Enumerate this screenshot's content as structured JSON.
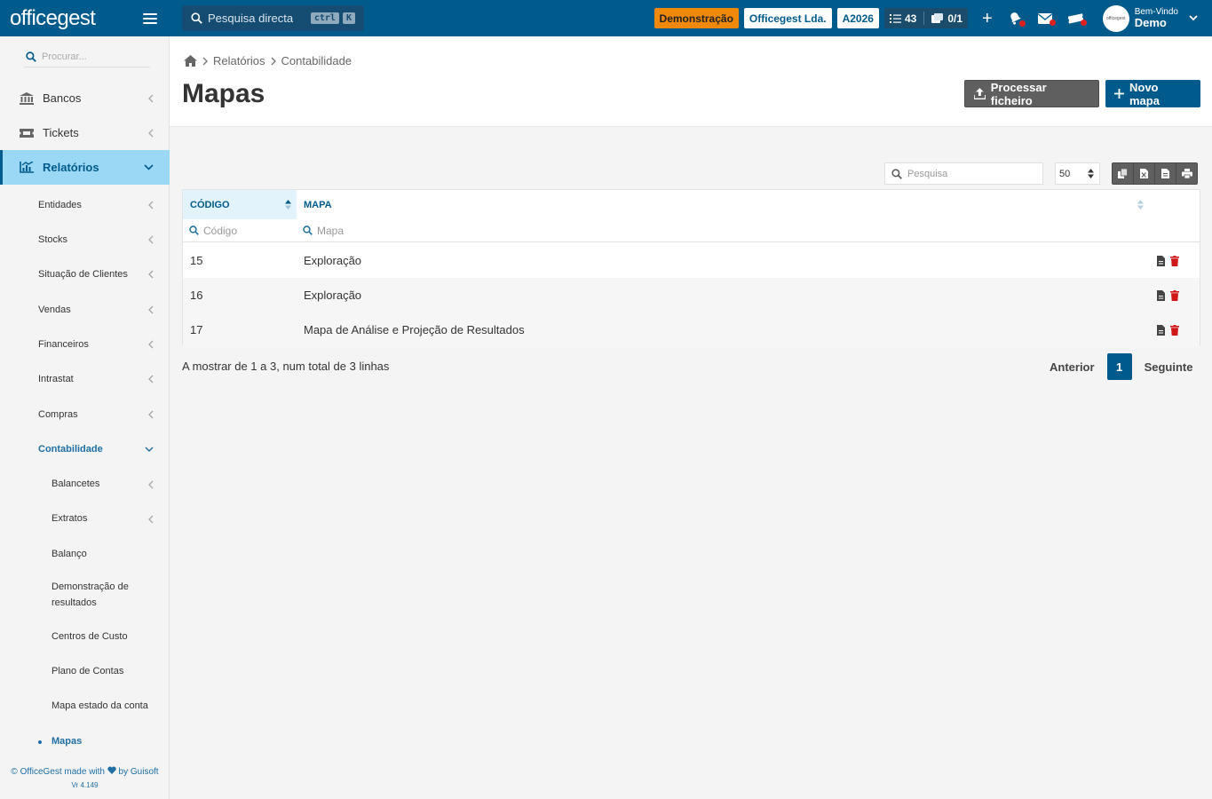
{
  "brand": {
    "logo": "officegest"
  },
  "topbar": {
    "quick_search_label": "Pesquisa directa",
    "kbd_ctrl": "ctrl",
    "kbd_k": "K",
    "demo_badge": "Demonstração",
    "company": "Officegest Lda.",
    "year": "A2026",
    "tasks_count": "43",
    "docs_count": "0/1",
    "welcome_line": "Bem-Vindo",
    "user_name": "Demo",
    "colors": {
      "bar": "#005b8c",
      "demo": "#f0890a",
      "alert_dot": "#e02020"
    }
  },
  "sidebar": {
    "search_placeholder": "Procurar...",
    "top_items": [
      {
        "label": "Bancos",
        "icon": "bank-icon"
      },
      {
        "label": "Tickets",
        "icon": "ticket-icon"
      },
      {
        "label": "Relatórios",
        "icon": "chart-icon"
      }
    ],
    "report_items": [
      "Entidades",
      "Stocks",
      "Situação de Clientes",
      "Vendas",
      "Financeiros",
      "Intrastat",
      "Compras",
      "Contabilidade"
    ],
    "accounting_items": [
      "Balancetes",
      "Extratos",
      "Balanço",
      "Demonstração de resultados",
      "Centros de Custo",
      "Plano de Contas",
      "Mapa estado da conta",
      "Mapas"
    ],
    "footer_prefix": "© OfficeGest made with",
    "footer_suffix": "by Guisoft",
    "version": "Vr 4.149"
  },
  "page": {
    "breadcrumb": [
      "Relatórios",
      "Contabilidade"
    ],
    "title": "Mapas",
    "process_button": "Processar ficheiro",
    "new_button": "Novo mapa"
  },
  "table": {
    "search_placeholder": "Pesquisa",
    "page_size": "50",
    "columns": [
      "CÓDIGO",
      "MAPA"
    ],
    "filters": [
      "Código",
      "Mapa"
    ],
    "rows": [
      {
        "code": "15",
        "map": "Exploração"
      },
      {
        "code": "16",
        "map": "Exploração"
      },
      {
        "code": "17",
        "map": "Mapa de Análise e Projeção de Resultados"
      }
    ],
    "info": "A mostrar de 1 a 3, num total de 3 linhas",
    "pagination": {
      "prev": "Anterior",
      "current": "1",
      "next": "Seguinte"
    }
  }
}
